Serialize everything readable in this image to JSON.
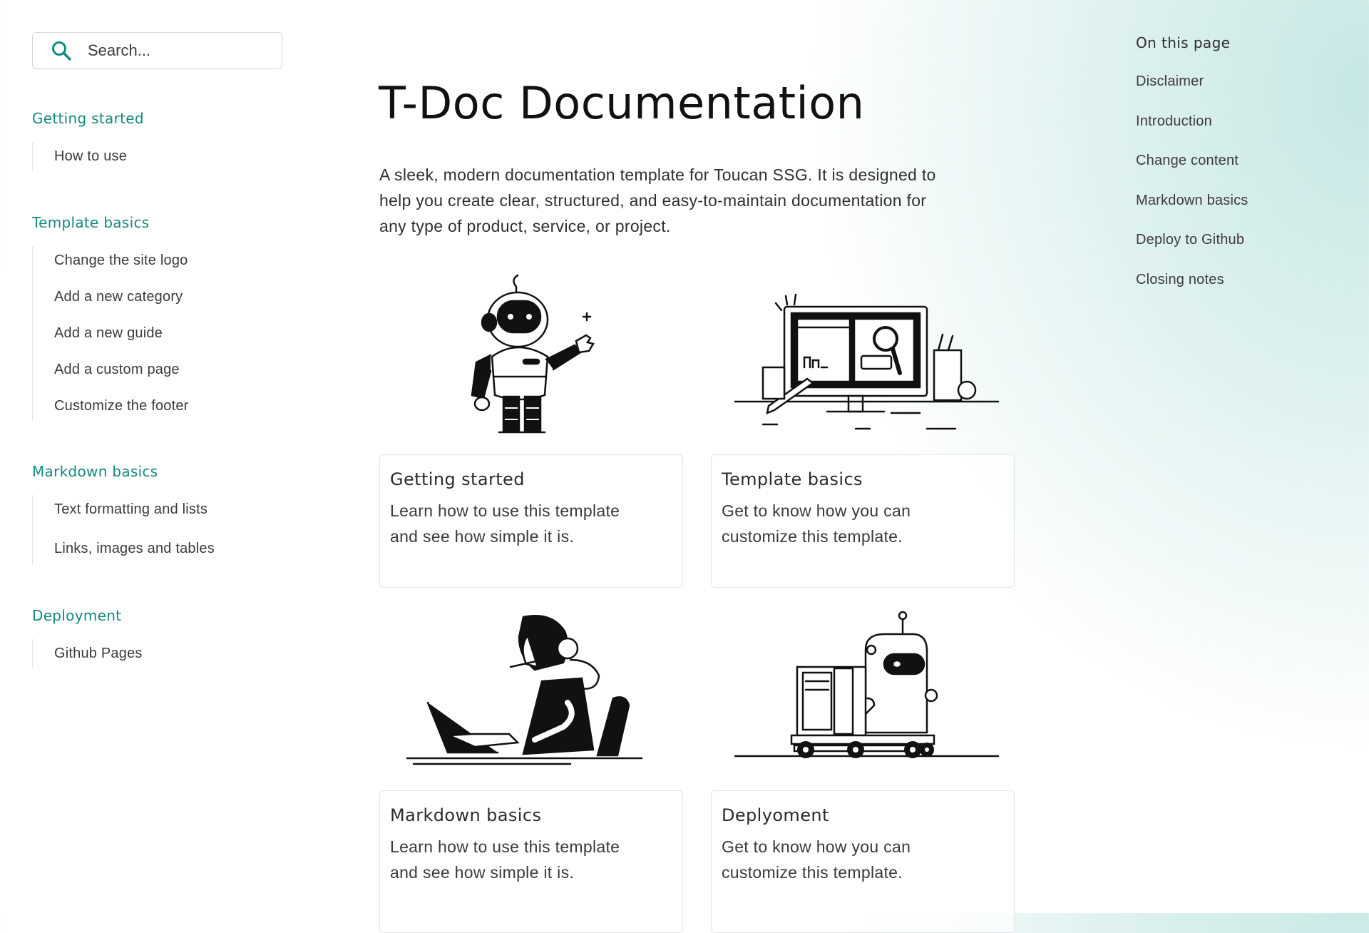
{
  "search": {
    "placeholder": "Search..."
  },
  "sidebar": {
    "sections": [
      {
        "title": "Getting started",
        "items": [
          "How to use"
        ]
      },
      {
        "title": "Template basics",
        "items": [
          "Change the site logo",
          "Add a new category",
          "Add a new guide",
          "Add a custom page",
          "Customize the footer"
        ]
      },
      {
        "title": "Markdown basics",
        "items": [
          "Text formatting and lists",
          "Links, images and tables"
        ]
      },
      {
        "title": "Deployment",
        "items": [
          "Github Pages"
        ]
      }
    ]
  },
  "main": {
    "title": "T-Doc Documentation",
    "intro": "A sleek, modern documentation template for Toucan SSG. It is designed to help you create clear, structured, and easy-to-maintain documentation for any type of product, service, or project.",
    "cards": [
      {
        "title": "Getting started",
        "description": "Learn how to use this template and see how simple it is.",
        "illustration": "robot-waving-icon"
      },
      {
        "title": "Template basics",
        "description": "Get to know how you can customize this template.",
        "illustration": "computer-desk-icon"
      },
      {
        "title": "Markdown basics",
        "description": "Learn how to use this template and see how simple it is.",
        "illustration": "robot-typing-laptop-icon"
      },
      {
        "title": "Deplyoment",
        "description": "Get to know how you can customize this template.",
        "illustration": "robot-pushing-cart-icon"
      }
    ]
  },
  "toc": {
    "title": "On this page",
    "items": [
      "Disclaimer",
      "Introduction",
      "Change content",
      "Markdown basics",
      "Deploy to Github",
      "Closing notes"
    ]
  },
  "colors": {
    "accent": "#13897d",
    "background_tint": "#c6e7e4"
  }
}
